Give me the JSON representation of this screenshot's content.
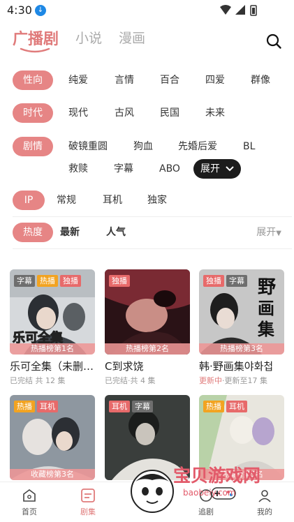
{
  "status_bar": {
    "time": "4:30"
  },
  "top_tabs": [
    {
      "label": "广播剧",
      "active": true
    },
    {
      "label": "小说",
      "active": false
    },
    {
      "label": "漫画",
      "active": false
    }
  ],
  "filters": {
    "orientation": {
      "label": "性向",
      "options": [
        "纯爱",
        "言情",
        "百合",
        "四爱",
        "群像"
      ]
    },
    "era": {
      "label": "时代",
      "options": [
        "现代",
        "古风",
        "民国",
        "未来"
      ]
    },
    "plot": {
      "label": "剧情",
      "options_row1": [
        "破镜重圆",
        "狗血",
        "先婚后爱",
        "BL"
      ],
      "options_row2": [
        "救赎",
        "字幕",
        "ABO"
      ],
      "expand_label": "展开"
    },
    "ip": {
      "label": "IP",
      "options": [
        "常规",
        "耳机",
        "独家"
      ]
    }
  },
  "sort": {
    "options": [
      "热度",
      "最新",
      "人气"
    ],
    "active": "热度",
    "more_label": "展开"
  },
  "cards": [
    {
      "title": "乐可全集（未删…",
      "tags": [
        "字幕",
        "热播",
        "独播"
      ],
      "rank": "热播榜第1名",
      "status": "已完结",
      "sub_rest": " 共 12 集",
      "cover_text": "乐可全集"
    },
    {
      "title": "C到求饶",
      "tags": [
        "独播"
      ],
      "rank": "热播榜第2名",
      "status": "已完结",
      "sub_rest": "·共 4 集",
      "cover_text": ""
    },
    {
      "title": "韩·野画集야화첩",
      "tags": [
        "独播",
        "字幕"
      ],
      "rank": "热播榜第3名",
      "status": "更新中",
      "sub_rest": "·更新至17 集",
      "cover_text": "野画集"
    },
    {
      "title": "",
      "tags": [
        "热播",
        "耳机"
      ],
      "rank": "收藏榜第3名",
      "status": "",
      "sub_rest": "",
      "cover_text": ""
    },
    {
      "title": "",
      "tags": [
        "耳机",
        "字幕"
      ],
      "rank": "",
      "status": "",
      "sub_rest": "",
      "cover_text": ""
    },
    {
      "title": "",
      "tags": [
        "热播",
        "耳机"
      ],
      "rank": "热播榜第5名",
      "status": "",
      "sub_rest": "",
      "cover_text": ""
    }
  ],
  "bottom_nav": [
    {
      "label": "首页",
      "active": false
    },
    {
      "label": "剧集",
      "active": true
    },
    {
      "label": "追剧",
      "active": false
    },
    {
      "label": "我的",
      "active": false
    }
  ],
  "watermark": {
    "text": "宝贝游戏网",
    "url": "baobeiy.com"
  },
  "colors": {
    "accent": "#e07b7b",
    "pill_active": "#e68585",
    "tag_red": "#e76a6a",
    "tag_yellow": "#f2a321"
  }
}
